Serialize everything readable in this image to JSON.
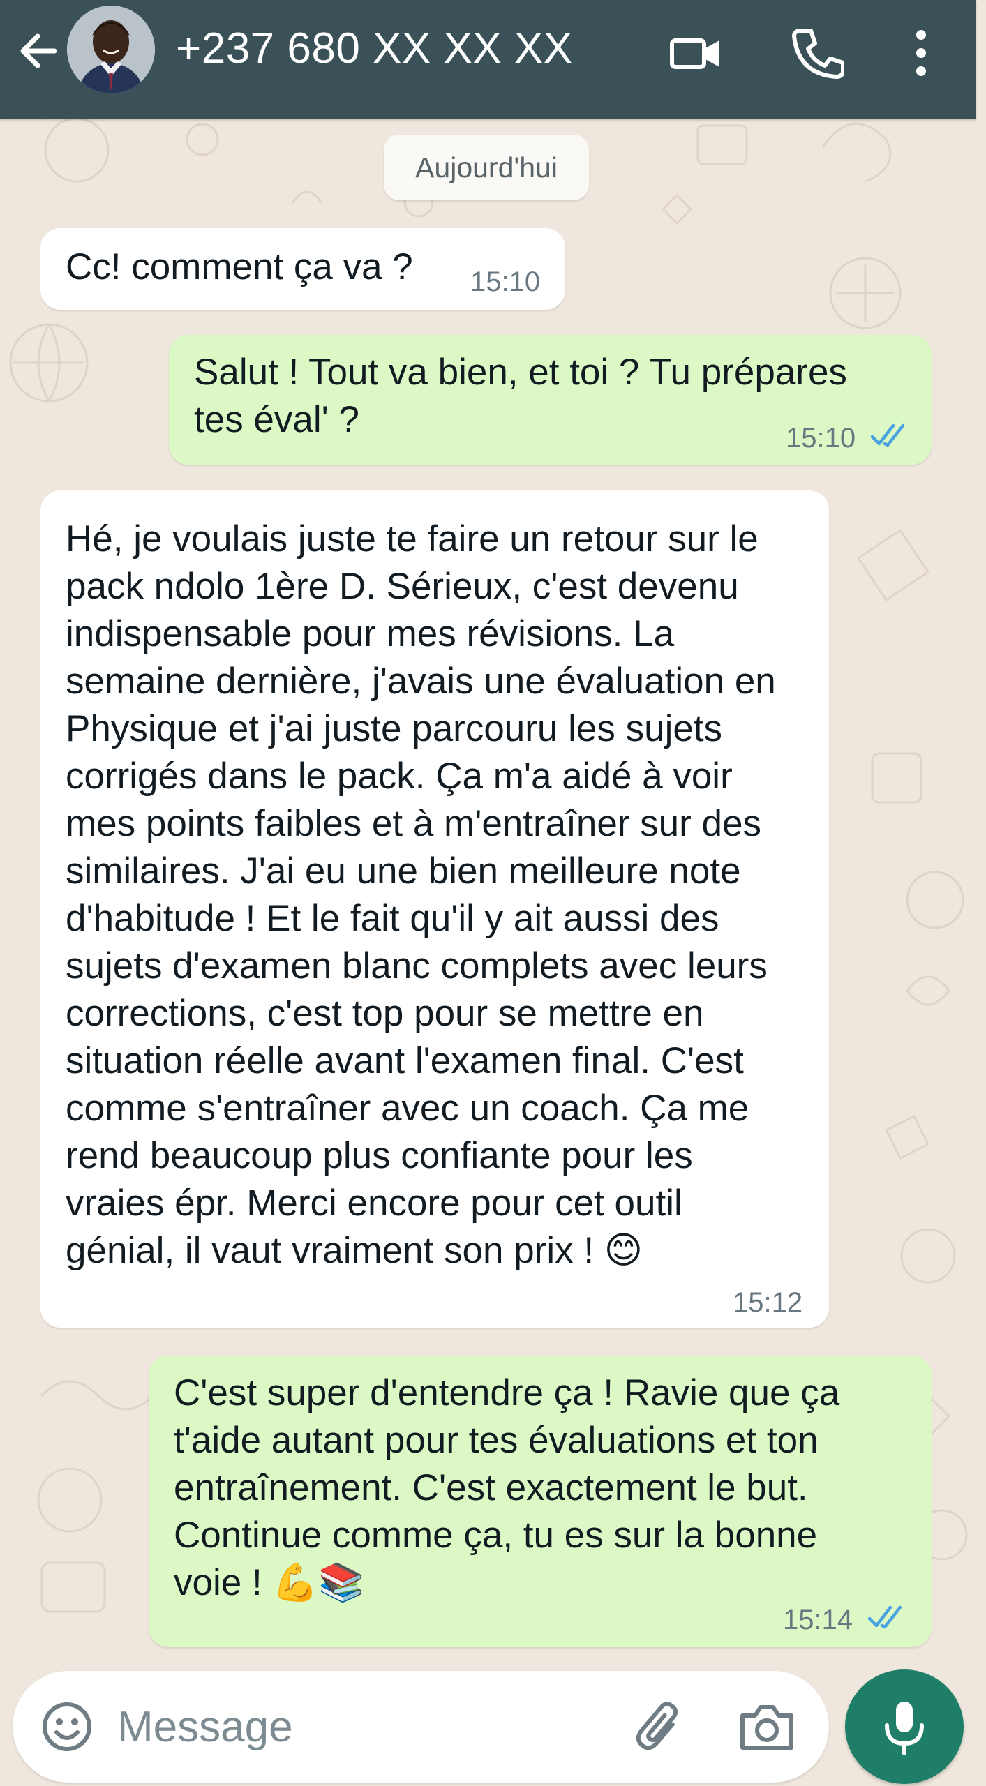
{
  "header": {
    "contact_name": "+237 680 XX XX XX",
    "back_icon": "arrow-left-icon",
    "video_icon": "video-camera-icon",
    "call_icon": "phone-icon",
    "menu_icon": "more-vertical-icon"
  },
  "date_chip": "Aujourd'hui",
  "messages": [
    {
      "direction": "incoming",
      "text": "Cc! comment ça va ?",
      "time": "15:10"
    },
    {
      "direction": "outgoing",
      "text": "Salut ! Tout va bien, et toi ? Tu prépares\ntes éval' ?",
      "time": "15:10",
      "status": "read"
    },
    {
      "direction": "incoming",
      "text": "Hé, je voulais juste te faire un retour sur le\npack ndolo 1ère D. Sérieux, c'est devenu\nindispensable pour mes révisions. La\nsemaine dernière, j'avais une évaluation en\nPhysique et j'ai juste parcouru les sujets\ncorrigés dans le pack. Ça m'a aidé à voir\nmes points faibles et à m'entraîner sur des\nsimilaires. J'ai eu une bien meilleure note\nd'habitude ! Et le fait qu'il y ait aussi des\nsujets d'examen blanc complets avec leurs\ncorrections, c'est top pour se mettre en\nsituation réelle avant l'examen final. C'est\ncomme s'entraîner avec un coach. Ça me\nrend beaucoup plus confiante pour les\nvraies épr. Merci encore pour cet outil\ngénial, il vaut vraiment son prix ! 😊",
      "time": "15:12"
    },
    {
      "direction": "outgoing",
      "text": "C'est super d'entendre ça ! Ravie que ça\nt'aide autant pour tes évaluations et ton\nentraînement. C'est exactement le but.\nContinue comme ça, tu es sur la bonne\nvoie ! 💪📚",
      "time": "15:14",
      "status": "read"
    }
  ],
  "composer": {
    "placeholder": "Message",
    "emoji_icon": "smiley-icon",
    "attach_icon": "paperclip-icon",
    "camera_icon": "camera-icon",
    "mic_icon": "microphone-icon"
  },
  "colors": {
    "header_bg": "#3a5158",
    "chat_bg": "#efe7dd",
    "incoming_bubble": "#ffffff",
    "outgoing_bubble": "#dbf8c5",
    "read_ticks": "#4aa3e0",
    "mic_button": "#1e7e67"
  }
}
